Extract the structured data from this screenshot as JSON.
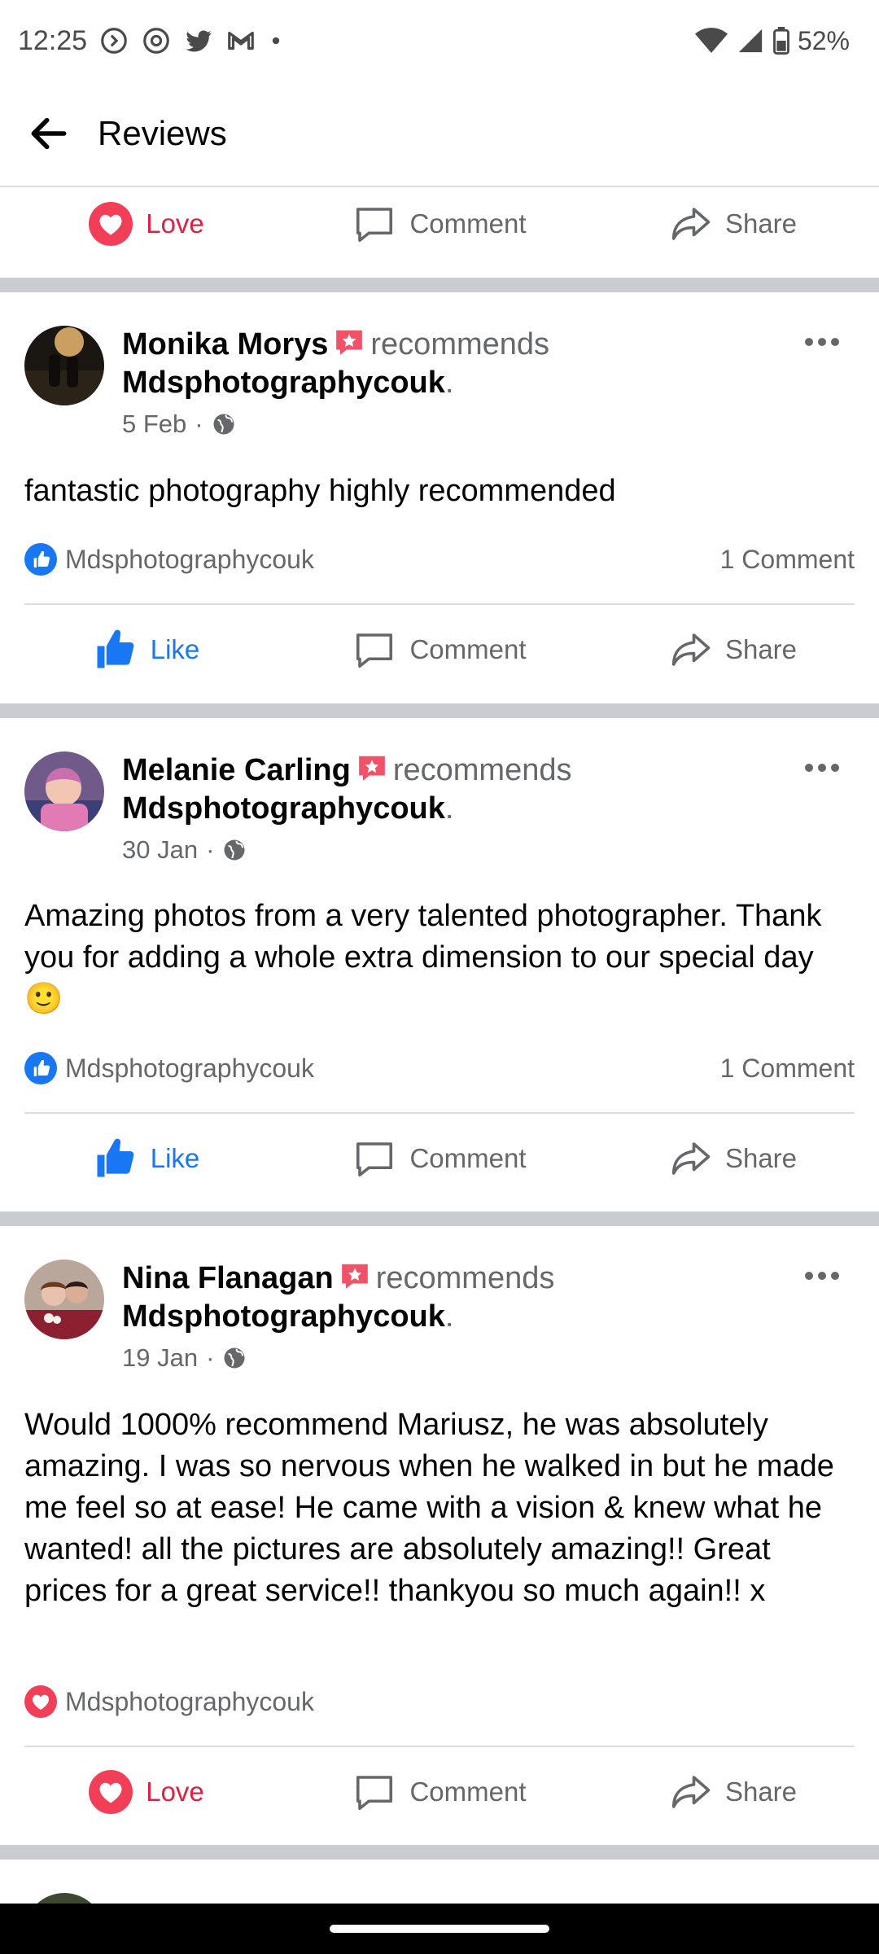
{
  "status_bar": {
    "time": "12:25",
    "battery": "52%",
    "icons": [
      "sync-icon",
      "threads-icon",
      "twitter-icon",
      "gmail-icon",
      "dot-icon",
      "wifi-icon",
      "signal-icon",
      "battery-icon"
    ]
  },
  "header": {
    "title": "Reviews",
    "back_icon": "back-arrow-icon"
  },
  "actions": {
    "love": "Love",
    "like": "Like",
    "comment": "Comment",
    "share": "Share"
  },
  "colors": {
    "love": "#e41e3f",
    "like": "#1877f2",
    "secondary_text": "#65676b",
    "separator": "#c9ccd1"
  },
  "posts": [
    {
      "author": "Monika Morys",
      "verb": "recommends",
      "page": "Mdsphotographycouk",
      "period": ".",
      "date": "5 Feb",
      "meta_sep": " · ",
      "text": "fantastic photography highly recommended",
      "reactor": "Mdsphotographycouk",
      "reaction": "like",
      "comments": "1 Comment",
      "action_state": "like"
    },
    {
      "author": "Melanie Carling",
      "verb": "recommends",
      "page": "Mdsphotographycouk",
      "period": ".",
      "date": "30 Jan",
      "meta_sep": " · ",
      "text": "Amazing photos from a very talented photographer. Thank you for adding a whole extra dimension to our special day 🙂",
      "reactor": "Mdsphotographycouk",
      "reaction": "like",
      "comments": "1 Comment",
      "action_state": "like"
    },
    {
      "author": "Nina Flanagan",
      "verb": "recommends",
      "page": "Mdsphotographycouk",
      "period": ".",
      "date": "19 Jan",
      "meta_sep": " · ",
      "text": "Would 1000% recommend Mariusz, he was absolutely amazing. I was so nervous when he walked in but he made me feel so at ease! He came with a vision & knew what he wanted! all the pictures are absolutely amazing!! Great prices for a great service!! thankyou so much again!! x",
      "reactor": "Mdsphotographycouk",
      "reaction": "love",
      "comments": "",
      "action_state": "love"
    }
  ]
}
